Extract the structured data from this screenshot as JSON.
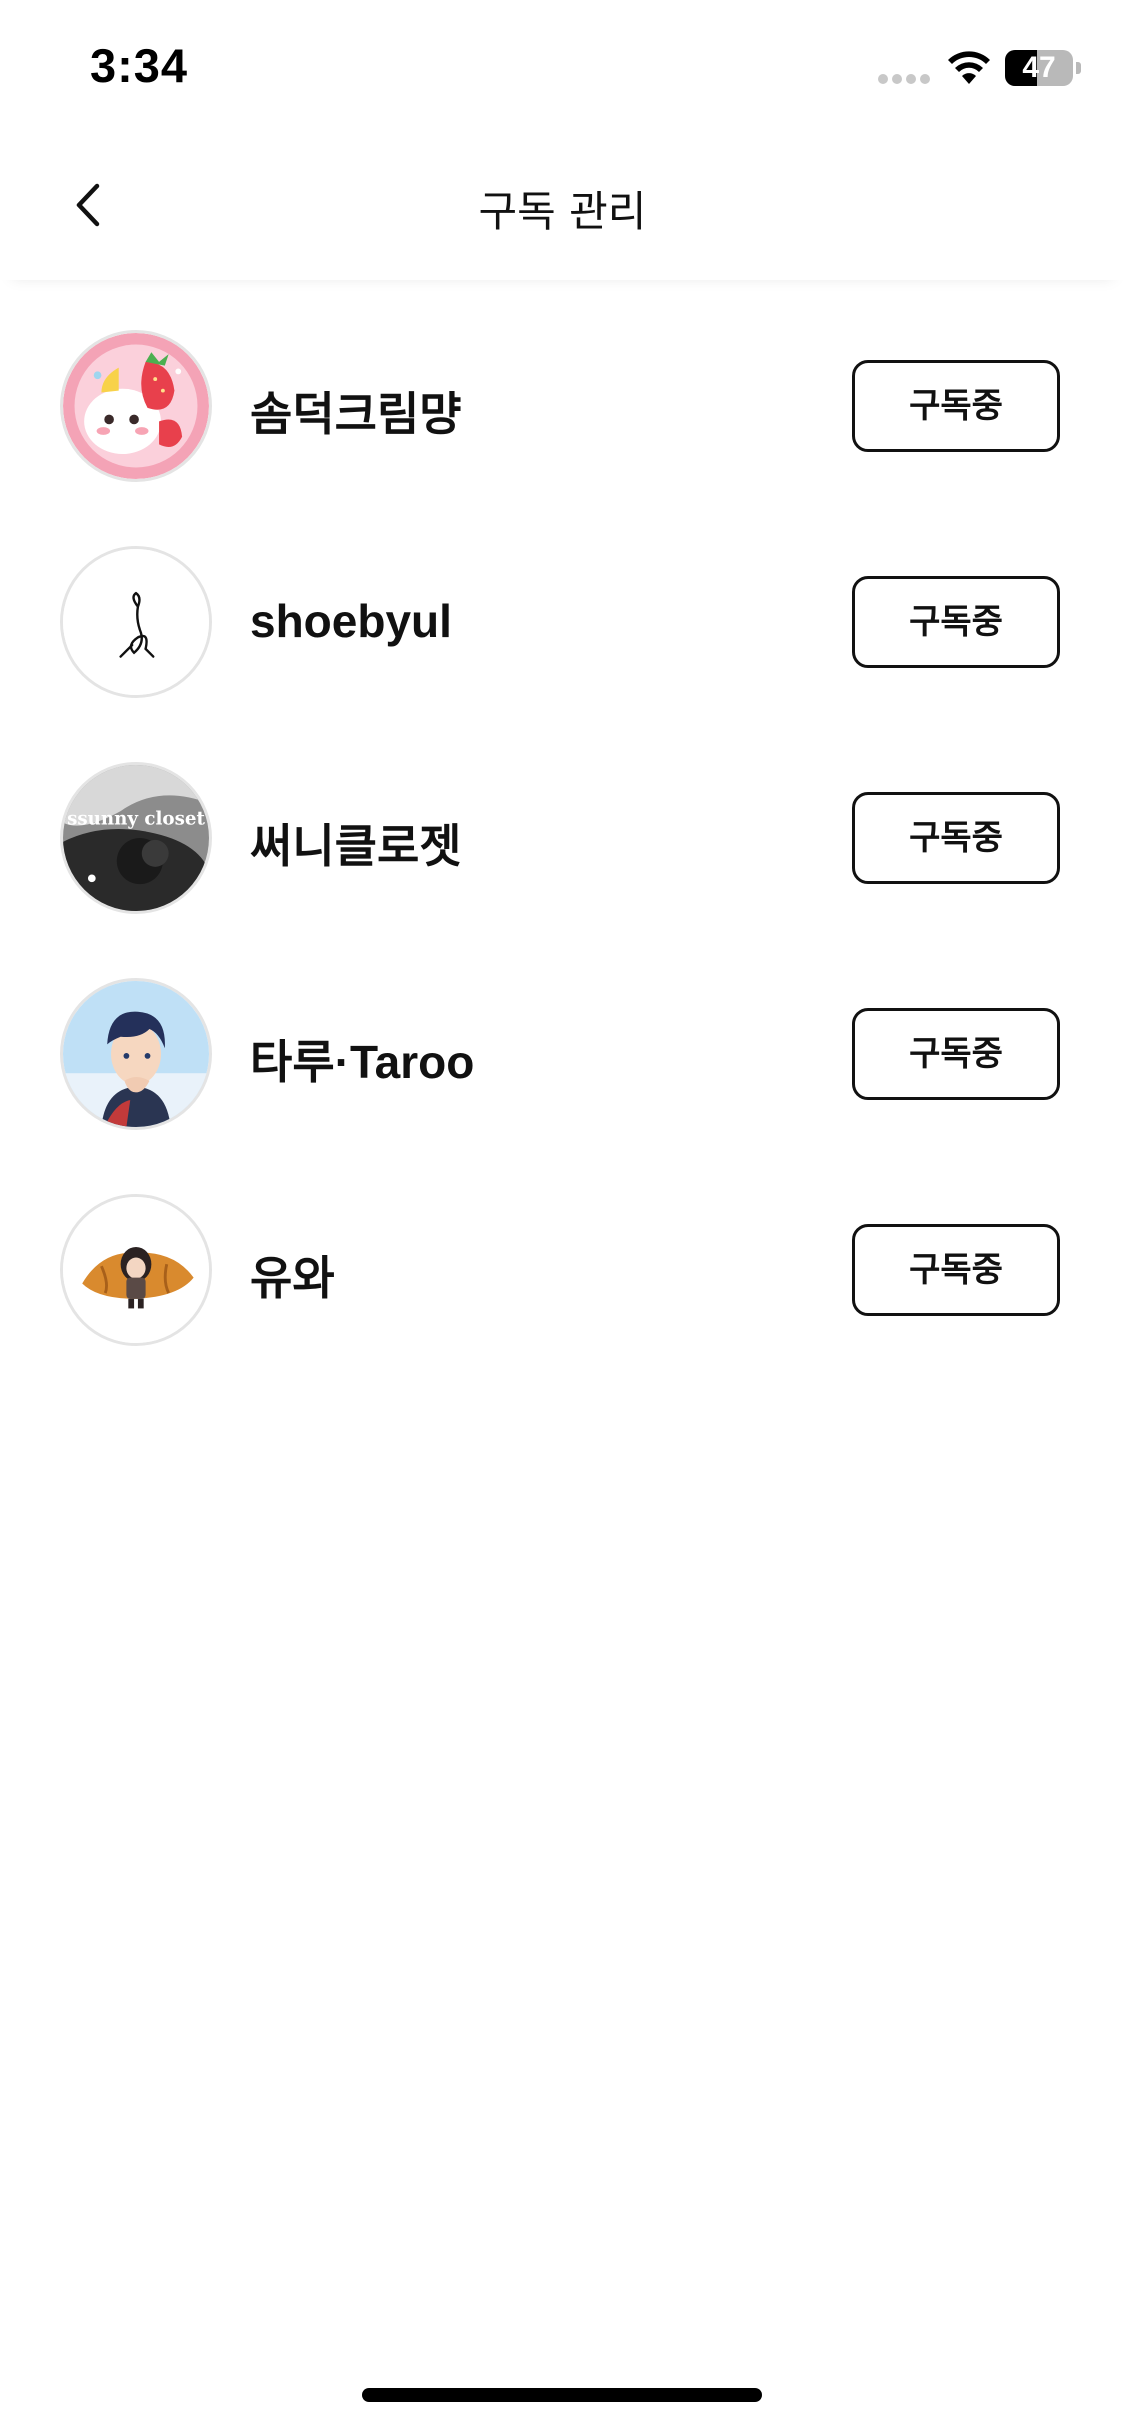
{
  "status_bar": {
    "time": "3:34",
    "battery_level": "47",
    "battery_fraction": 0.47,
    "icons": [
      "cellular-signal-icon",
      "wifi-icon",
      "battery-icon"
    ]
  },
  "header": {
    "title": "구독 관리",
    "back_icon": "chevron-left-icon"
  },
  "subscriptions": [
    {
      "name": "솜덕크림먕",
      "button_label": "구독중",
      "avatar_icon": "strawberry-cream-avatar"
    },
    {
      "name": "shoebyul",
      "button_label": "구독중",
      "avatar_icon": "sketch-figure-avatar"
    },
    {
      "name": "써니클로젯",
      "button_label": "구독중",
      "avatar_icon": "sunny-closet-avatar",
      "avatar_text": "ssunny closet"
    },
    {
      "name": "타루·Taroo",
      "button_label": "구독중",
      "avatar_icon": "anime-character-avatar"
    },
    {
      "name": "유와",
      "button_label": "구독중",
      "avatar_icon": "croissant-character-avatar"
    }
  ],
  "colors": {
    "background": "#ffffff",
    "text": "#111111",
    "button_border": "#111111",
    "avatar_border": "#e4e4e4"
  }
}
